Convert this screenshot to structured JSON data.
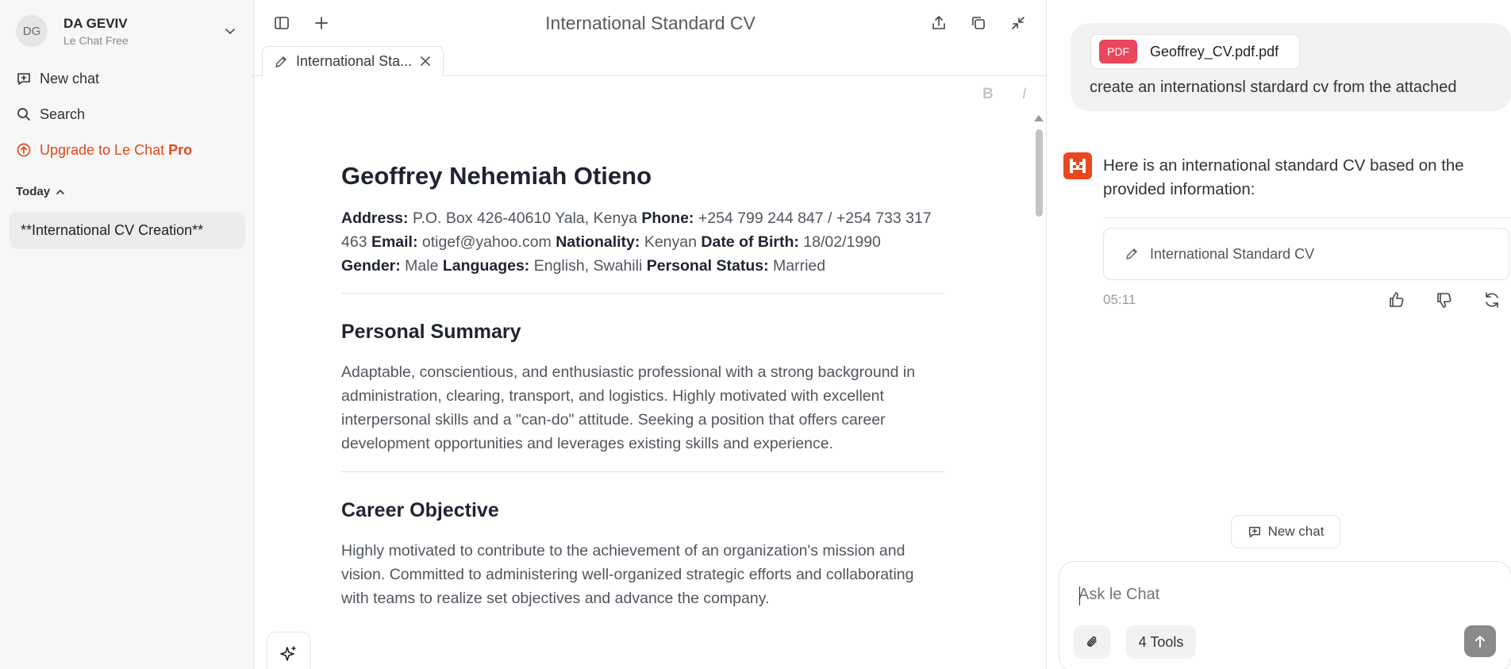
{
  "account": {
    "initials": "DG",
    "name": "DA GEVIV",
    "plan": "Le Chat Free"
  },
  "sidebar": {
    "new_chat": "New chat",
    "search": "Search",
    "upgrade_prefix": "Upgrade to Le Chat ",
    "upgrade_pro": "Pro",
    "section_today": "Today",
    "conversations": [
      "**International CV Creation**"
    ]
  },
  "editor": {
    "title": "International Standard CV",
    "tab_label": "International Sta...",
    "format_bold": "B",
    "format_italic": "I",
    "doc": {
      "name": "Geoffrey Nehemiah Otieno",
      "details": [
        {
          "label": "Address:",
          "value": " P.O. Box 426-40610 Yala, Kenya "
        },
        {
          "label": "Phone:",
          "value": " +254 799 244 847 / +254 733 317 463 "
        },
        {
          "label": "Email:",
          "value": " otigef@yahoo.com "
        },
        {
          "label": "Nationality:",
          "value": " Kenyan "
        },
        {
          "label": "Date of Birth:",
          "value": " 18/02/1990 "
        },
        {
          "label": "Gender:",
          "value": " Male "
        },
        {
          "label": "Languages:",
          "value": " English, Swahili "
        },
        {
          "label": "Personal Status:",
          "value": " Married"
        }
      ],
      "summary_heading": "Personal Summary",
      "summary_text": "Adaptable, conscientious, and enthusiastic professional with a strong background in administration, clearing, transport, and logistics. Highly motivated with excellent interpersonal skills and a \"can-do\" attitude. Seeking a position that offers career development opportunities and leverages existing skills and experience.",
      "objective_heading": "Career Objective",
      "objective_text": "Highly motivated to contribute to the achievement of an organization's mission and vision. Committed to administering well-organized strategic efforts and collaborating with teams to realize set objectives and advance the company."
    }
  },
  "chat": {
    "attachment_badge": "PDF",
    "attachment_name": "Geoffrey_CV.pdf.pdf",
    "user_message": "create an internationsl stardard cv from the attached",
    "bot_message": "Here is an international standard CV based on the provided information:",
    "card_label": "International Standard CV",
    "timestamp": "05:11",
    "new_chat": "New chat",
    "input_placeholder": "Ask le Chat",
    "tools_label": "4 Tools"
  },
  "colors": {
    "accent": "#e0481d",
    "pdf_badge": "#e8475c",
    "logo": "#e9481e"
  }
}
